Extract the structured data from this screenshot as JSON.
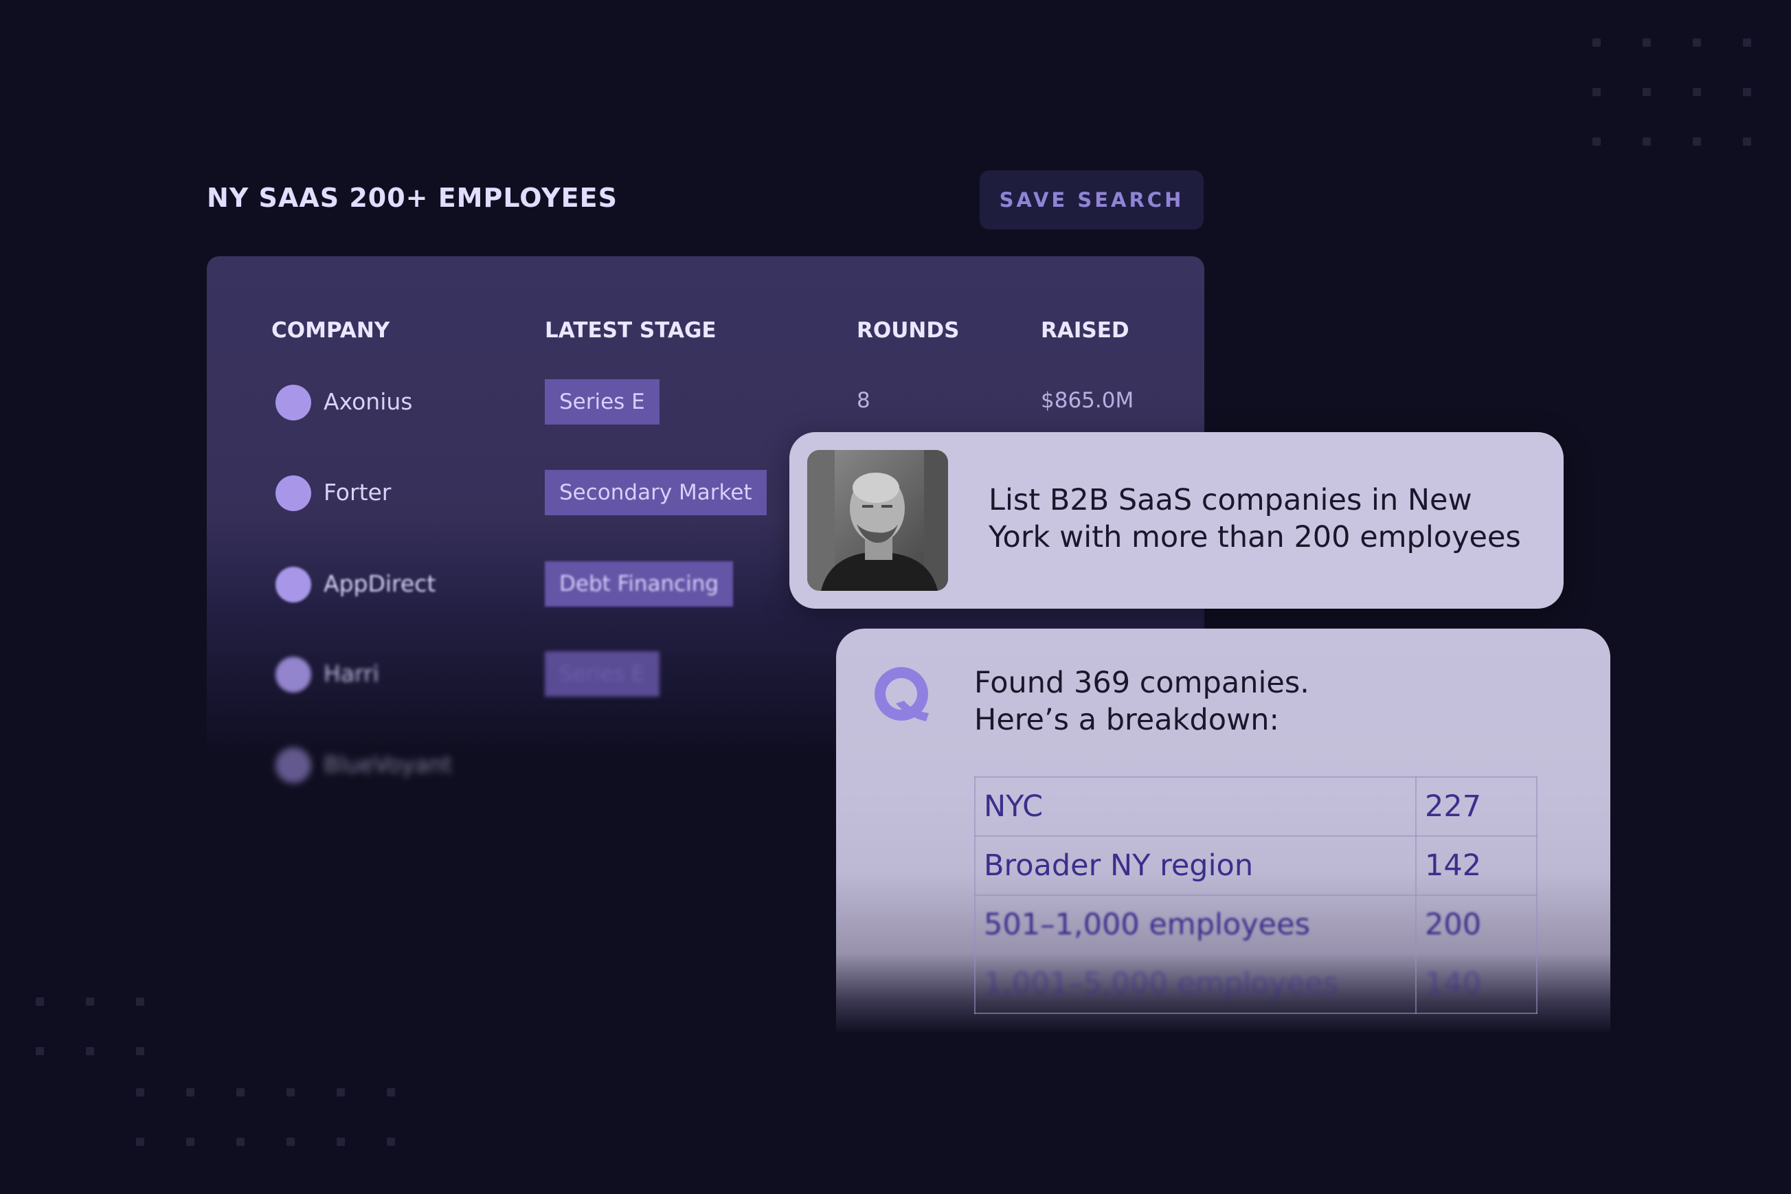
{
  "search": {
    "title": "NY SAAS 200+ EMPLOYEES",
    "save_label": "SAVE SEARCH"
  },
  "table": {
    "headers": {
      "company": "COMPANY",
      "stage": "LATEST STAGE",
      "rounds": "ROUNDS",
      "raised": "RAISED"
    },
    "rows": [
      {
        "company": "Axonius",
        "stage": "Series E",
        "rounds": "8",
        "raised": "$865.0M"
      },
      {
        "company": "Forter",
        "stage": "Secondary Market"
      },
      {
        "company": "AppDirect",
        "stage": "Debt Financing"
      },
      {
        "company": "Harri",
        "stage": "Series E"
      },
      {
        "company": "BlueVoyant"
      }
    ]
  },
  "chat": {
    "prompt": "List B2B SaaS companies in New York with more than 200 employees",
    "answer_line1": "Found 369 companies.",
    "answer_line2": "Here’s a breakdown:",
    "breakdown": [
      {
        "label": "NYC",
        "count": "227"
      },
      {
        "label": "Broader NY region",
        "count": "142"
      },
      {
        "label": "501–1,000 employees",
        "count": "200"
      },
      {
        "label": "1,001–5,000 employees",
        "count": "140"
      }
    ]
  },
  "colors": {
    "background": "#0f0e20",
    "table_card": "#393360",
    "accent": "#8f7fe0",
    "chip": "#6555a6",
    "chat_card": "#c9c5e0"
  },
  "icons": {
    "user_avatar": "user-photo",
    "assistant": "q-logo-icon",
    "company_logo": "circle-logo"
  }
}
